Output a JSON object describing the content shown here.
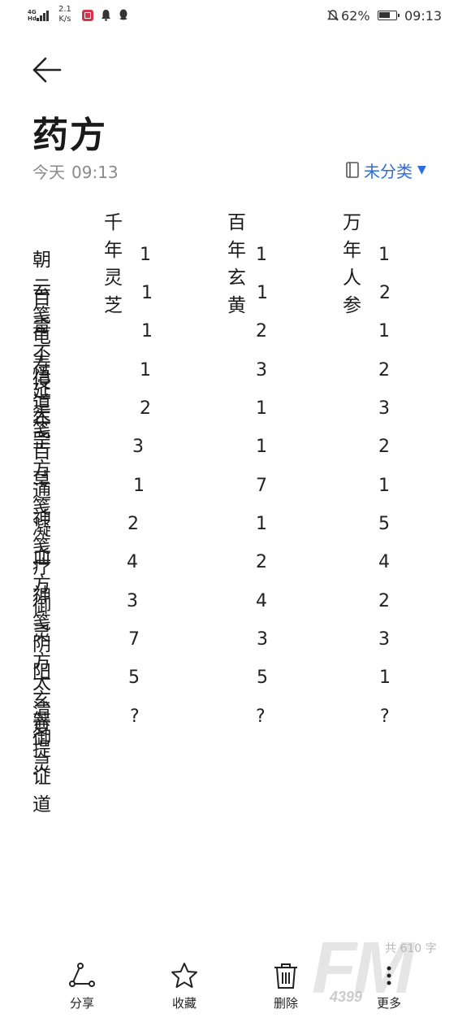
{
  "status_bar": {
    "network": "4G",
    "network_sub": "Hd",
    "speed_value": "2.1",
    "speed_unit": "K/s",
    "battery": "62%",
    "time": "09:13"
  },
  "note": {
    "title": "药方",
    "date": "今天",
    "time": "09:13",
    "category": "未分类"
  },
  "table": {
    "headers": [
      "千年灵芝",
      "百年玄黄",
      "万年人参"
    ],
    "rows": [
      {
        "name": "朝云笺",
        "values": [
          "1",
          "1",
          "1"
        ]
      },
      {
        "name": "百毒不侵",
        "values": [
          "1",
          "1",
          "2"
        ]
      },
      {
        "name": "龟寿延年",
        "values": [
          "1",
          "2",
          "1"
        ]
      },
      {
        "name": "悟道笺",
        "values": [
          "1",
          "3",
          "2"
        ]
      },
      {
        "name": "天罡方",
        "values": [
          "2",
          "1",
          "3"
        ]
      },
      {
        "name": "百草笺",
        "values": [
          "3",
          "1",
          "2"
        ]
      },
      {
        "name": "通神笺",
        "values": [
          "1",
          "7",
          "1"
        ]
      },
      {
        "name": "凝血方",
        "values": [
          "2",
          "1",
          "5"
        ]
      },
      {
        "name": "疗神笺",
        "values": [
          "4",
          "2",
          "4"
        ]
      },
      {
        "name": "御灵方",
        "values": [
          "3",
          "4",
          "2"
        ]
      },
      {
        "name": "阴阳玄变",
        "values": [
          "7",
          "3",
          "3"
        ]
      },
      {
        "name": "太清御灵",
        "values": [
          "5",
          "5",
          "1"
        ]
      },
      {
        "name": "菩提证道",
        "values": [
          "?",
          "?",
          "?"
        ]
      }
    ]
  },
  "word_count": "共 610 字",
  "toolbar": {
    "share": "分享",
    "favorite": "收藏",
    "delete": "删除",
    "more": "更多"
  },
  "watermark": {
    "brand": "FM",
    "sub": "4399"
  },
  "colors": {
    "accent": "#2b6de0",
    "text": "#1a1a1a",
    "meta": "#8a8a8a"
  }
}
